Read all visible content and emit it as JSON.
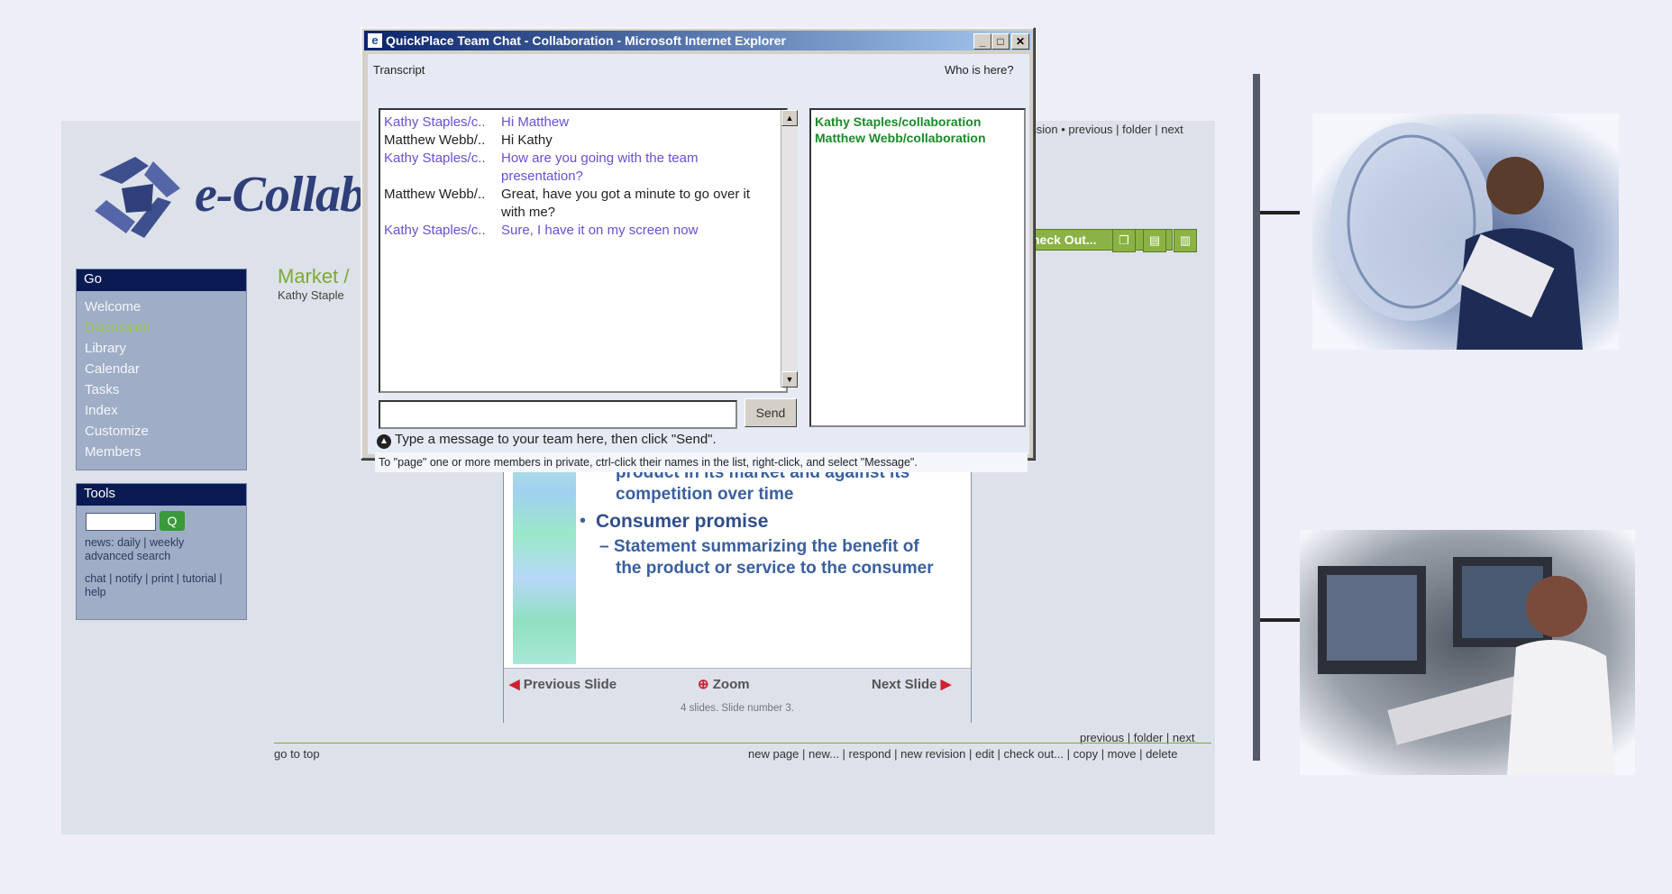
{
  "app": {
    "logo_text": "e-Collab",
    "go": {
      "header": "Go",
      "items": [
        "Welcome",
        "Discussion",
        "Library",
        "Calendar",
        "Tasks",
        "Index",
        "Customize",
        "Members"
      ],
      "active": "Discussion"
    },
    "tools": {
      "header": "Tools",
      "search_go": "Q",
      "news_line": "news: daily | weekly",
      "advanced": "advanced search",
      "links_line1": "chat | notify | print | tutorial |",
      "links_line2": "help"
    },
    "page_title": "Market /",
    "page_author": "Kathy Staple",
    "top_links": "ussion • previous | folder | next",
    "checkout_label": "heck Out...",
    "slide": {
      "line1": "product in its market and against its",
      "line2": "competition over time",
      "bullet": "Consumer promise",
      "sub1": "– Statement summarizing the benefit of",
      "sub2": "the product or service to the consumer",
      "prev": "Previous Slide",
      "zoom": "Zoom",
      "next": "Next Slide",
      "count": "4 slides. Slide number 3."
    },
    "bottom_links": "previous | folder | next",
    "go_to_top": "go to top",
    "actions": "new page | new... | respond | new revision | edit | check out... | copy | move | delete"
  },
  "chat": {
    "title": "QuickPlace Team Chat - Collaboration - Microsoft Internet Explorer",
    "transcript_label": "Transcript",
    "whois_label": "Who is here?",
    "messages": [
      {
        "who": "Kathy Staples/c..",
        "text": "Hi Matthew"
      },
      {
        "who": "Matthew Webb/..",
        "text": "Hi Kathy"
      },
      {
        "who": "Kathy Staples/c..",
        "text": "How are you going with the team presentation?"
      },
      {
        "who": "Matthew Webb/..",
        "text": "Great, have you got a minute to go over it with me?"
      },
      {
        "who": "Kathy Staples/c..",
        "text": "Sure, I have it on my screen now"
      }
    ],
    "members": [
      "Kathy Staples/collaboration",
      "Matthew Webb/collaboration"
    ],
    "input_value": "",
    "send_label": "Send",
    "hint": "Type a message to your team here, then click \"Send\".",
    "page_note": "To \"page\" one or more members in private, ctrl-click their names in the list, right-click, and select \"Message\"."
  }
}
